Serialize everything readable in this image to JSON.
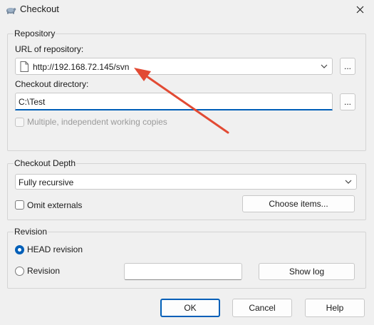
{
  "window": {
    "title": "Checkout"
  },
  "repository": {
    "group_label": "Repository",
    "url_label": "URL of repository:",
    "url_value": "http://192.168.72.145/svn",
    "browse_url_label": "...",
    "dir_label": "Checkout directory:",
    "dir_value": "C:\\Test",
    "browse_dir_label": "...",
    "multiple_copies_label": "Multiple, independent working copies"
  },
  "depth": {
    "group_label": "Checkout Depth",
    "selected": "Fully recursive",
    "omit_externals_label": "Omit externals",
    "choose_items_label": "Choose items..."
  },
  "revision": {
    "group_label": "Revision",
    "head_label": "HEAD revision",
    "revision_label": "Revision",
    "revision_value": "",
    "show_log_label": "Show log"
  },
  "buttons": {
    "ok": "OK",
    "cancel": "Cancel",
    "help": "Help"
  },
  "colors": {
    "accent": "#005fb8",
    "annotation_arrow": "#e24a33"
  }
}
